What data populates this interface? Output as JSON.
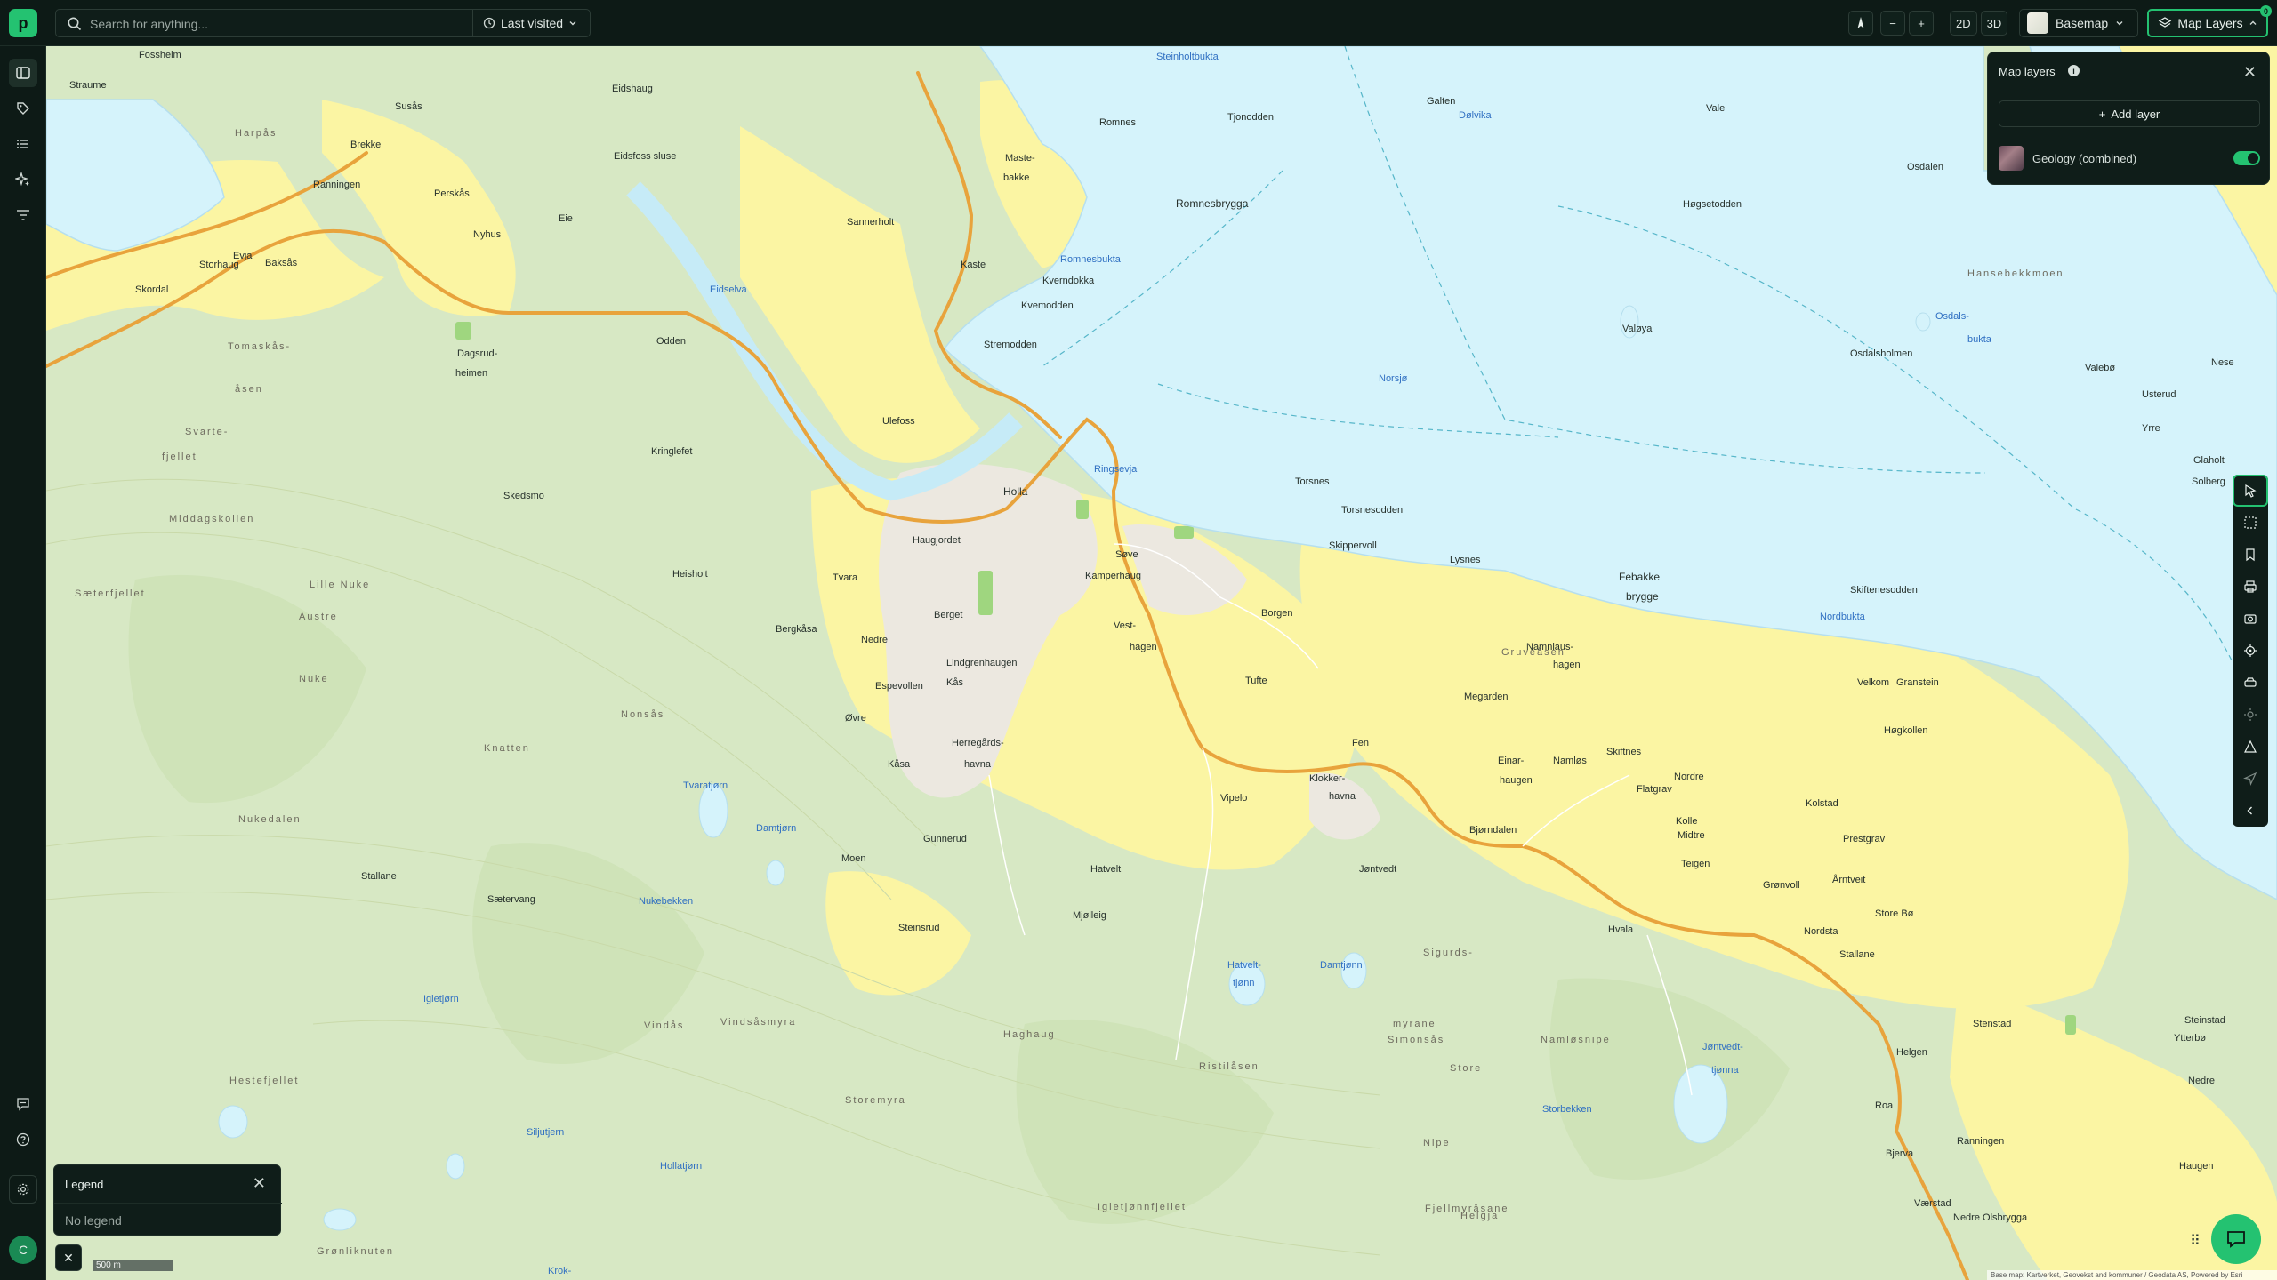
{
  "app": {
    "logo_letter": "p"
  },
  "search": {
    "placeholder": "Search for anything...",
    "recent_label": "Last visited"
  },
  "toolbar": {
    "zoom_out": "−",
    "zoom_in": "+",
    "mode_2d": "2D",
    "mode_3d": "3D",
    "basemap_label": "Basemap",
    "layers_label": "Map Layers",
    "layers_count": "0"
  },
  "sidebar": {
    "items": [
      {
        "name": "map-view-icon"
      },
      {
        "name": "tag-icon"
      },
      {
        "name": "list-icon"
      },
      {
        "name": "ai-sparkle-icon"
      },
      {
        "name": "filter-icon"
      }
    ],
    "bottom": [
      {
        "name": "feedback-icon"
      },
      {
        "name": "help-icon"
      },
      {
        "name": "settings-icon"
      }
    ],
    "avatar_initial": "C"
  },
  "layers_panel": {
    "title": "Map layers",
    "info": "i",
    "add_label": "Add layer",
    "layers": [
      {
        "name": "Geology (combined)",
        "enabled": true
      }
    ]
  },
  "legend": {
    "title": "Legend",
    "empty_text": "No legend"
  },
  "scale": {
    "label": "500 m"
  },
  "attribution": "Base map: Kartverket, Geovekst and kommuner / Geodata AS, Powered by Esri",
  "map_labels": {
    "places": [
      "Fossheim",
      "Straume",
      "Susås",
      "Eidshaug",
      "Harpås",
      "Brekke",
      "Ranningen",
      "Perskås",
      "Eie",
      "Nyhus",
      "Eidsfoss sluse",
      "Baksås",
      "Evja",
      "Skordal",
      "Storhaug",
      "Dagsrud-",
      "heimen",
      "Odden",
      "Tomaskås-",
      "åsen",
      "Svarte-",
      "fjellet",
      "Middagskollen",
      "Skedsmo",
      "Kringlefet",
      "Ulefoss",
      "Holla",
      "Haugjordet",
      "Heisholt",
      "Tvara",
      "Bergkåsa",
      "Nedre",
      "Berget",
      "Lindgrenhaugen",
      "Espevollen",
      "Kås",
      "Øvre",
      "Herregårds-",
      "havna",
      "Kåsa",
      "Gunnerud",
      "Moen",
      "Stallane",
      "Sætervang",
      "Sæterfjellet",
      "Lille Nuke",
      "Austre",
      "Nuke",
      "Nonsås",
      "Knatten",
      "Nukedalen",
      "Steinholtbukta",
      "Tjonodden",
      "Romnes",
      "Maste-",
      "bakke",
      "Romnesbrygga",
      "Sannerholt",
      "Kaste",
      "Kverndokka",
      "Kvemodden",
      "Stremodden",
      "Søve",
      "Kamperhaug",
      "Vest-",
      "hagen",
      "Borgen",
      "Tufte",
      "Fen",
      "Klokker-",
      "havna",
      "Vipelo",
      "Hatvelt",
      "Mjølleig",
      "Steinsrud",
      "Galten",
      "Vale",
      "Osdalen",
      "Høgsetodden",
      "Valøya",
      "Osdalsholmen",
      "Torsnes",
      "Torsnesodden",
      "Skippervoll",
      "Lysnes",
      "Febakke",
      "brygge",
      "Skiftenesodden",
      "Namnlaus-",
      "hagen",
      "Gruveåsen",
      "Megarden",
      "Einar-",
      "haugen",
      "Namløs",
      "Nordre",
      "Kolle",
      "Midtre",
      "Teigen",
      "Bjørndalen",
      "Jøntvedt",
      "Hvala",
      "Grønvoll",
      "Nordsta",
      "Store Bø",
      "Prestgrav",
      "Årntveit",
      "Kolstad",
      "Flatgrav",
      "Skiftnes",
      "Granstein",
      "Velkom",
      "Høgkollen",
      "Sigurds-",
      "myrane",
      "Simonsås",
      "Namløsnipe",
      "Store",
      "Nipe",
      "Fjellmyråsane",
      "Helgja",
      "Helgen",
      "Roa",
      "Bjerva",
      "Ranningen",
      "Værstad",
      "Nedre Olsbrygga",
      "Steinstad",
      "Ytterbø",
      "Stenstad",
      "Nedre",
      "Glaholt",
      "Solberg",
      "Yrre",
      "Valebø",
      "Usterud",
      "Nese",
      "Haugen",
      "Stallane"
    ],
    "water": [
      "Eidselva",
      "Dølvika",
      "Romnesbukta",
      "Ringsevja",
      "Norsjø",
      "Tvaratjørn",
      "Damtjørn",
      "Nukebekken",
      "Igletjørn",
      "Siljutjern",
      "Hollatjørn",
      "Hatvelt-",
      "tjønn",
      "Damtjønn",
      "Jøntvedt-",
      "tjønna",
      "Storbekken",
      "Nordbukta",
      "Osdals-",
      "bukta",
      "Krok-",
      "Hansebekkmoen"
    ],
    "terrain": [
      "Vindsåsmyra",
      "Haghaug",
      "Storemyra",
      "Hestefjellet",
      "Ristilåsen",
      "Igletjønnfjellet",
      "Grønliknuten",
      "Vindås"
    ]
  },
  "colors": {
    "accent": "#24c271",
    "water": "#d5f3fb",
    "forest": "#d8e9c6",
    "farmland": "#fbf5a3",
    "road_main": "#e8a33c"
  }
}
